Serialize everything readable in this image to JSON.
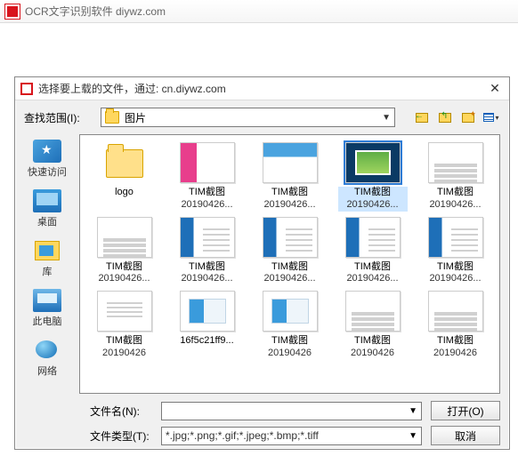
{
  "app": {
    "title": "OCR文字识别软件 diywz.com"
  },
  "dialog": {
    "title": "选择要上载的文件，通过: cn.diywz.com",
    "lookin_label": "查找范围(I):",
    "lookin_value": "图片",
    "places": {
      "quick": "快速访问",
      "desktop": "桌面",
      "libraries": "库",
      "thispc": "此电脑",
      "network": "网络"
    },
    "files": [
      {
        "name": "logo",
        "sub": "",
        "kind": "folder"
      },
      {
        "name": "TIM截图",
        "sub": "20190426...",
        "kind": "img1"
      },
      {
        "name": "TIM截图",
        "sub": "20190426...",
        "kind": "img2"
      },
      {
        "name": "TIM截图",
        "sub": "20190426...",
        "kind": "img3",
        "selected": true
      },
      {
        "name": "TIM截图",
        "sub": "20190426...",
        "kind": "doc"
      },
      {
        "name": "TIM截图",
        "sub": "20190426...",
        "kind": "doc"
      },
      {
        "name": "TIM截图",
        "sub": "20190426...",
        "kind": "app"
      },
      {
        "name": "TIM截图",
        "sub": "20190426...",
        "kind": "app"
      },
      {
        "name": "TIM截图",
        "sub": "20190426...",
        "kind": "app"
      },
      {
        "name": "TIM截图",
        "sub": "20190426...",
        "kind": "app"
      },
      {
        "name": "TIM截图",
        "sub": "20190426",
        "kind": "blue"
      },
      {
        "name": "16f5c21ff9...",
        "sub": "",
        "kind": "card"
      },
      {
        "name": "TIM截图",
        "sub": "20190426",
        "kind": "card"
      },
      {
        "name": "TIM截图",
        "sub": "20190426",
        "kind": "doc"
      },
      {
        "name": "TIM截图",
        "sub": "20190426",
        "kind": "doc"
      }
    ],
    "filename_label": "文件名(N):",
    "filename_value": "",
    "filetype_label": "文件类型(T):",
    "filetype_value": "*.jpg;*.png;*.gif;*.jpeg;*.bmp;*.tiff",
    "open_btn": "打开(O)",
    "cancel_btn": "取消"
  }
}
